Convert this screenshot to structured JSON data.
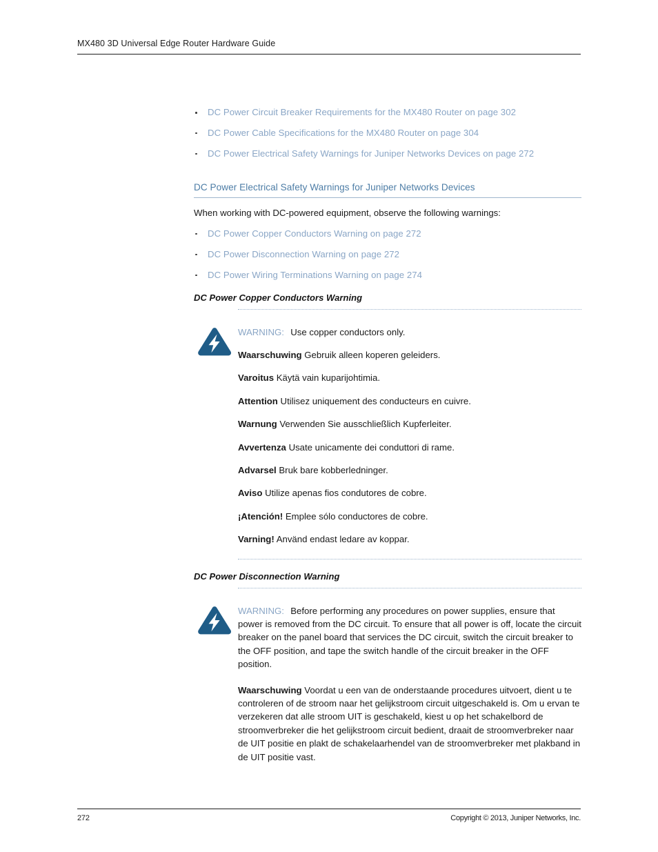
{
  "document": {
    "running_header": "MX480 3D Universal Edge Router Hardware Guide",
    "colors": {
      "link": "#8aa6c6",
      "heading": "#4d7da6",
      "icon_blue": "#1f5c87",
      "body_text": "#1a1a1a"
    }
  },
  "top_links": [
    {
      "label": "DC Power Circuit Breaker Requirements for the MX480 Router on page 302"
    },
    {
      "label": "DC Power Cable Specifications for the MX480 Router on page 304"
    },
    {
      "label": "DC Power Electrical Safety Warnings for Juniper Networks Devices on page 272"
    }
  ],
  "section": {
    "heading": "DC Power Electrical Safety Warnings for Juniper Networks Devices",
    "intro": "When working with DC-powered equipment, observe the following warnings:",
    "links": [
      {
        "label": "DC Power Copper Conductors Warning on page 272"
      },
      {
        "label": "DC Power Disconnection Warning on page 272"
      },
      {
        "label": "DC Power Wiring Terminations Warning on page 274"
      }
    ]
  },
  "warning_copper": {
    "sub_heading": "DC Power Copper Conductors Warning",
    "icon": "electrical-warning-icon",
    "english_label": "WARNING:",
    "english_text": "Use copper conductors only.",
    "translations": [
      {
        "label": "Waarschuwing",
        "text": "Gebruik alleen koperen geleiders."
      },
      {
        "label": "Varoitus",
        "text": "Käytä vain kuparijohtimia."
      },
      {
        "label": "Attention",
        "text": "Utilisez uniquement des conducteurs en cuivre."
      },
      {
        "label": "Warnung",
        "text": "Verwenden Sie ausschließlich Kupferleiter."
      },
      {
        "label": "Avvertenza",
        "text": "Usate unicamente dei conduttori di rame."
      },
      {
        "label": "Advarsel",
        "text": "Bruk bare kobberledninger."
      },
      {
        "label": "Aviso",
        "text": "Utilize apenas fios condutores de cobre."
      },
      {
        "label": "¡Atención!",
        "text": "Emplee sólo conductores de cobre."
      },
      {
        "label": "Varning!",
        "text": "Använd endast ledare av koppar."
      }
    ]
  },
  "warning_disconnection": {
    "sub_heading": "DC Power Disconnection Warning",
    "icon": "electrical-warning-icon",
    "english_label": "WARNING:",
    "english_text": "Before performing any procedures on power supplies, ensure that power is removed from the DC circuit. To ensure that all power is off, locate the circuit breaker on the panel board that services the DC circuit, switch the circuit breaker to the OFF position, and tape the switch handle of the circuit breaker in the OFF position.",
    "translations": [
      {
        "label": "Waarschuwing",
        "text": "Voordat u een van de onderstaande procedures uitvoert, dient u te controleren of de stroom naar het gelijkstroom circuit uitgeschakeld is. Om u ervan te verzekeren dat alle stroom UIT is geschakeld, kiest u op het schakelbord de stroomverbreker die het gelijkstroom circuit bedient, draait de stroomverbreker naar de UIT positie en plakt de schakelaarhendel van de stroomverbreker met plakband in de UIT positie vast."
      }
    ]
  },
  "footer": {
    "page_number": "272",
    "copyright": "Copyright © 2013, Juniper Networks, Inc."
  }
}
